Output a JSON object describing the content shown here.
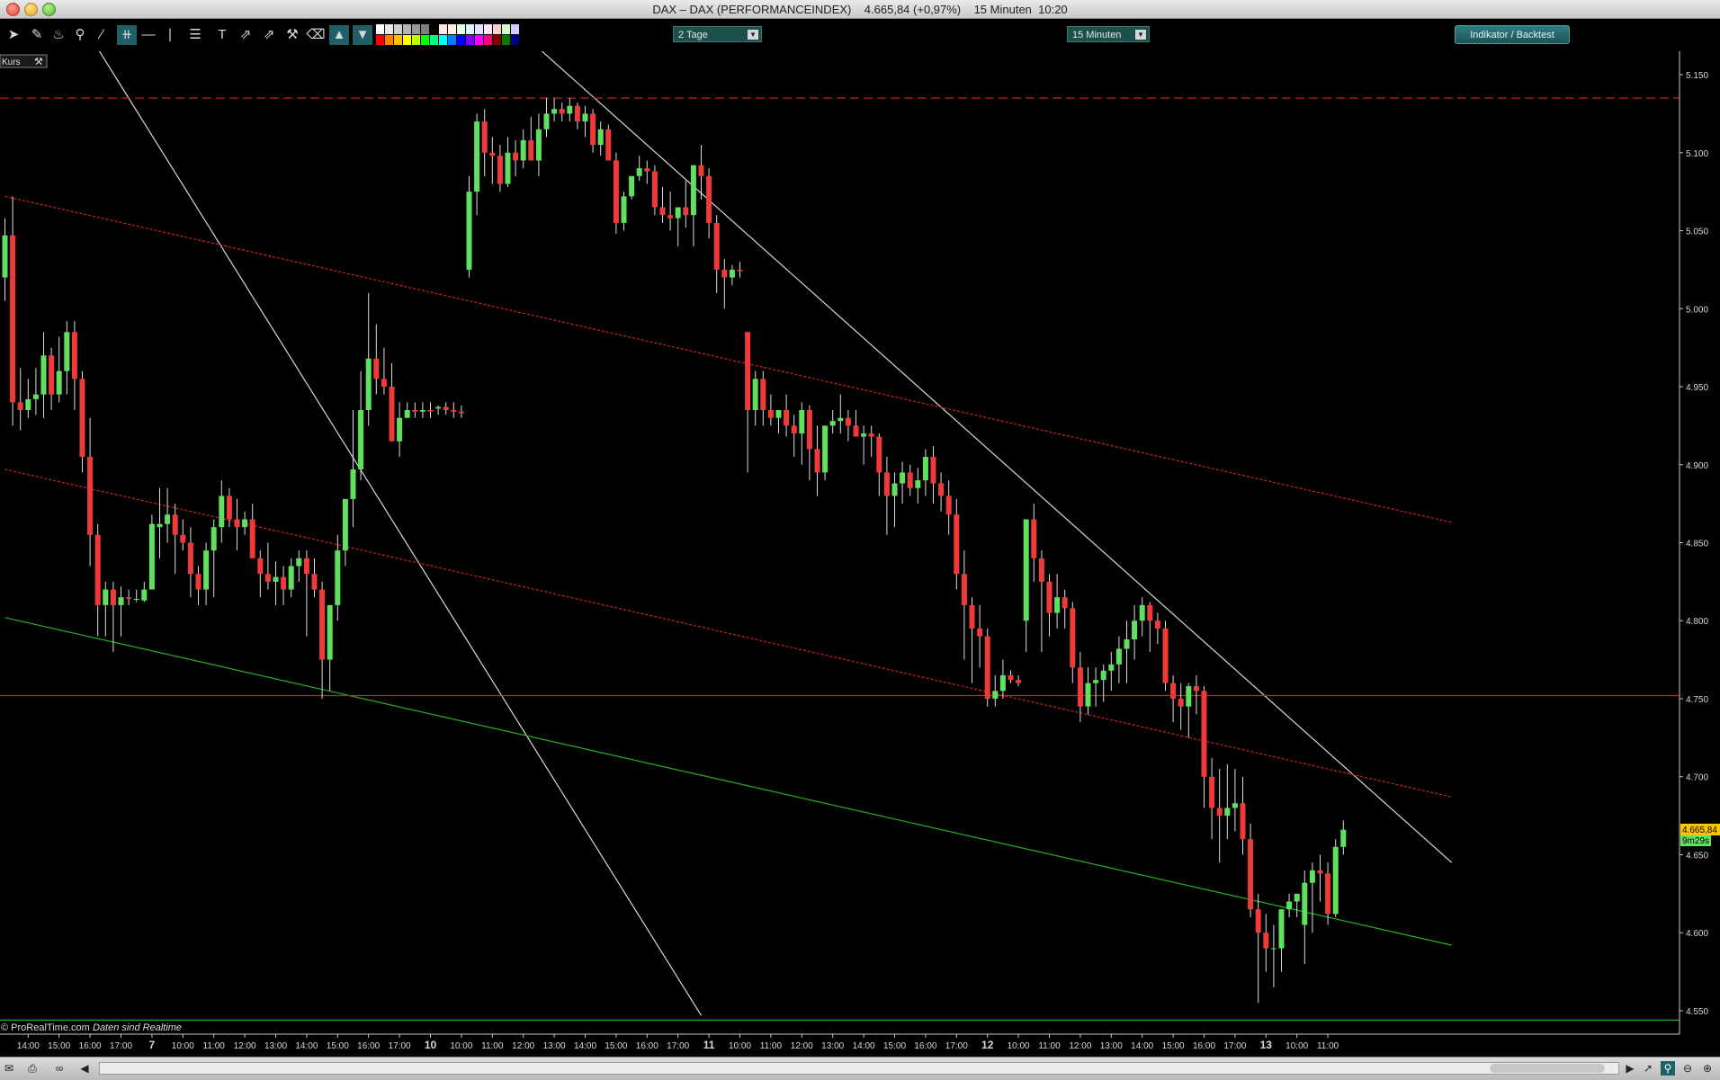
{
  "window": {
    "title": "DAX – DAX (PERFORMANCEINDEX)    4.665,84 (+0,97%)    15 Minuten  10:20"
  },
  "toolbar": {
    "period_dropdown": "2 Tage",
    "interval_dropdown": "15 Minuten",
    "indicator_button": "Indikator / Backtest",
    "tools": [
      "pointer-icon",
      "ruler-icon",
      "bell-icon",
      "zoom-icon",
      "line-icon",
      "channel-icon",
      "horizontal-line-icon",
      "vertical-line-icon",
      "fibonacci-icon",
      "text-icon",
      "trendline-icon",
      "trendline-icon",
      "wrench-icon",
      "trash-icon"
    ],
    "palette_top": [
      "#ffffff",
      "#e8e8e8",
      "#cfcfcf",
      "#b5b5b5",
      "#9a9a9a",
      "#7f7f7f",
      "#000000",
      "#ffe7e7",
      "#fff4d8",
      "#e4ffe4",
      "#d8f4ff",
      "#e4e4ff",
      "#ffe4ff",
      "#ffd0d0",
      "#d0ffd0",
      "#d0d0ff"
    ],
    "palette_bottom": [
      "#ff0000",
      "#ff7f00",
      "#ffbf00",
      "#ffff00",
      "#bfff00",
      "#00ff00",
      "#00ff7f",
      "#00ffff",
      "#007fff",
      "#0000ff",
      "#7f00ff",
      "#ff00ff",
      "#ff007f",
      "#7f0000",
      "#007f00",
      "#00007f"
    ]
  },
  "chart": {
    "panel_label": "Kurs",
    "footer": "© ProRealTime.com",
    "footer_note": "Daten sind Realtime",
    "last_price_label": "4.665,84",
    "countdown_label": "9m29s",
    "colors": {
      "up": "#5fe05f",
      "down": "#f03a3a",
      "wick": "#dcdcdc",
      "trend_white": "#d8d8d8",
      "trend_red": "#d42020",
      "trend_green": "#22b022"
    }
  },
  "chart_data": {
    "type": "candlestick",
    "ylim": [
      4535,
      5165
    ],
    "y_ticks": [
      {
        "value": 5150,
        "label": "5.150"
      },
      {
        "value": 5100,
        "label": "5.100"
      },
      {
        "value": 5050,
        "label": "5.050"
      },
      {
        "value": 5000,
        "label": "5.000"
      },
      {
        "value": 4950,
        "label": "4.950"
      },
      {
        "value": 4900,
        "label": "4.900"
      },
      {
        "value": 4850,
        "label": "4.850"
      },
      {
        "value": 4800,
        "label": "4.800"
      },
      {
        "value": 4750,
        "label": "4.750"
      },
      {
        "value": 4700,
        "label": "4.700"
      },
      {
        "value": 4650,
        "label": "4.650"
      },
      {
        "value": 4600,
        "label": "4.600"
      },
      {
        "value": 4550,
        "label": "4.550"
      }
    ],
    "x_ticks": [
      {
        "i": 3,
        "label": "14:00"
      },
      {
        "i": 7,
        "label": "15:00"
      },
      {
        "i": 11,
        "label": "16:00"
      },
      {
        "i": 15,
        "label": "17:00"
      },
      {
        "i": 19,
        "label": "7",
        "bold": true
      },
      {
        "i": 23,
        "label": "10:00"
      },
      {
        "i": 27,
        "label": "11:00"
      },
      {
        "i": 31,
        "label": "12:00"
      },
      {
        "i": 35,
        "label": "13:00"
      },
      {
        "i": 39,
        "label": "14:00"
      },
      {
        "i": 43,
        "label": "15:00"
      },
      {
        "i": 47,
        "label": "16:00"
      },
      {
        "i": 51,
        "label": "17:00"
      },
      {
        "i": 55,
        "label": "10",
        "bold": true
      },
      {
        "i": 59,
        "label": "10:00"
      },
      {
        "i": 63,
        "label": "11:00"
      },
      {
        "i": 67,
        "label": "12:00"
      },
      {
        "i": 71,
        "label": "13:00"
      },
      {
        "i": 75,
        "label": "14:00"
      },
      {
        "i": 79,
        "label": "15:00"
      },
      {
        "i": 83,
        "label": "16:00"
      },
      {
        "i": 87,
        "label": "17:00"
      },
      {
        "i": 91,
        "label": "11",
        "bold": true
      },
      {
        "i": 95,
        "label": "10:00"
      },
      {
        "i": 99,
        "label": "11:00"
      },
      {
        "i": 103,
        "label": "12:00"
      },
      {
        "i": 107,
        "label": "13:00"
      },
      {
        "i": 111,
        "label": "14:00"
      },
      {
        "i": 115,
        "label": "15:00"
      },
      {
        "i": 119,
        "label": "16:00"
      },
      {
        "i": 123,
        "label": "17:00"
      },
      {
        "i": 127,
        "label": "12",
        "bold": true
      },
      {
        "i": 131,
        "label": "10:00"
      },
      {
        "i": 135,
        "label": "11:00"
      },
      {
        "i": 139,
        "label": "12:00"
      },
      {
        "i": 143,
        "label": "13:00"
      },
      {
        "i": 147,
        "label": "14:00"
      },
      {
        "i": 151,
        "label": "15:00"
      },
      {
        "i": 155,
        "label": "16:00"
      },
      {
        "i": 159,
        "label": "17:00"
      },
      {
        "i": 163,
        "label": "13",
        "bold": true
      },
      {
        "i": 167,
        "label": "10:00"
      },
      {
        "i": 171,
        "label": "11:00"
      }
    ],
    "candles": [
      [
        5020,
        5058,
        5005,
        5047
      ],
      [
        5047,
        5072,
        4925,
        4940
      ],
      [
        4940,
        4962,
        4922,
        4935
      ],
      [
        4935,
        4955,
        4930,
        4942
      ],
      [
        4942,
        4962,
        4932,
        4945
      ],
      [
        4945,
        4985,
        4930,
        4970
      ],
      [
        4970,
        4975,
        4935,
        4945
      ],
      [
        4945,
        4982,
        4940,
        4960
      ],
      [
        4960,
        4992,
        4945,
        4985
      ],
      [
        4985,
        4992,
        4935,
        4955
      ],
      [
        4955,
        4960,
        4895,
        4905
      ],
      [
        4905,
        4930,
        4835,
        4855
      ],
      [
        4855,
        4862,
        4790,
        4810
      ],
      [
        4810,
        4825,
        4790,
        4820
      ],
      [
        4820,
        4825,
        4780,
        4810
      ],
      [
        4810,
        4822,
        4790,
        4815
      ],
      [
        4815,
        4820,
        4810,
        4814
      ],
      [
        4814,
        4820,
        4812,
        4814
      ],
      [
        4813,
        4825,
        4812,
        4820
      ],
      [
        4820,
        4868,
        4825,
        4862
      ],
      [
        4860,
        4885,
        4840,
        4862
      ],
      [
        4862,
        4885,
        4850,
        4868
      ],
      [
        4868,
        4875,
        4830,
        4855
      ],
      [
        4855,
        4865,
        4845,
        4850
      ],
      [
        4850,
        4860,
        4815,
        4830
      ],
      [
        4830,
        4835,
        4810,
        4820
      ],
      [
        4820,
        4850,
        4810,
        4845
      ],
      [
        4845,
        4865,
        4815,
        4860
      ],
      [
        4860,
        4890,
        4850,
        4880
      ],
      [
        4880,
        4885,
        4860,
        4865
      ],
      [
        4865,
        4878,
        4845,
        4860
      ],
      [
        4860,
        4870,
        4855,
        4865
      ],
      [
        4865,
        4875,
        4840,
        4840
      ],
      [
        4840,
        4845,
        4815,
        4830
      ],
      [
        4830,
        4850,
        4820,
        4825
      ],
      [
        4825,
        4838,
        4810,
        4828
      ],
      [
        4828,
        4835,
        4810,
        4820
      ],
      [
        4820,
        4840,
        4815,
        4835
      ],
      [
        4835,
        4845,
        4825,
        4840
      ],
      [
        4840,
        4845,
        4790,
        4830
      ],
      [
        4830,
        4840,
        4815,
        4820
      ],
      [
        4820,
        4825,
        4750,
        4775
      ],
      [
        4775,
        4810,
        4755,
        4810
      ],
      [
        4810,
        4855,
        4800,
        4845
      ],
      [
        4845,
        4878,
        4835,
        4878
      ],
      [
        4878,
        4935,
        4860,
        4897
      ],
      [
        4897,
        4960,
        4890,
        4935
      ],
      [
        4935,
        5010,
        4925,
        4968
      ],
      [
        4968,
        4990,
        4945,
        4955
      ],
      [
        4955,
        4975,
        4945,
        4950
      ],
      [
        4950,
        4965,
        4915,
        4915
      ],
      [
        4915,
        4940,
        4905,
        4930
      ],
      [
        4930,
        4940,
        4930,
        4935
      ],
      [
        4935,
        4940,
        4930,
        4934
      ],
      [
        4934,
        4940,
        4930,
        4935
      ],
      [
        4935,
        4940,
        4930,
        4934
      ],
      [
        4936,
        4938,
        4932,
        4937
      ],
      [
        4937,
        4940,
        4932,
        4935
      ],
      [
        4935,
        4940,
        4930,
        4934
      ],
      [
        4934,
        4938,
        4930,
        4933
      ],
      [
        5025,
        5085,
        5020,
        5075
      ],
      [
        5075,
        5125,
        5060,
        5120
      ],
      [
        5120,
        5128,
        5085,
        5100
      ],
      [
        5100,
        5110,
        5080,
        5098
      ],
      [
        5098,
        5105,
        5075,
        5080
      ],
      [
        5080,
        5110,
        5078,
        5100
      ],
      [
        5100,
        5108,
        5085,
        5095
      ],
      [
        5095,
        5115,
        5090,
        5108
      ],
      [
        5108,
        5123,
        5095,
        5095
      ],
      [
        5095,
        5125,
        5085,
        5115
      ],
      [
        5115,
        5135,
        5110,
        5125
      ],
      [
        5125,
        5135,
        5120,
        5128
      ],
      [
        5128,
        5132,
        5120,
        5125
      ],
      [
        5125,
        5135,
        5120,
        5130
      ],
      [
        5130,
        5132,
        5115,
        5120
      ],
      [
        5120,
        5130,
        5110,
        5125
      ],
      [
        5125,
        5128,
        5100,
        5105
      ],
      [
        5105,
        5120,
        5098,
        5115
      ],
      [
        5115,
        5118,
        5095,
        5095
      ],
      [
        5095,
        5100,
        5048,
        5055
      ],
      [
        5055,
        5075,
        5050,
        5072
      ],
      [
        5072,
        5085,
        5070,
        5085
      ],
      [
        5085,
        5098,
        5082,
        5090
      ],
      [
        5090,
        5095,
        5080,
        5088
      ],
      [
        5088,
        5092,
        5060,
        5065
      ],
      [
        5065,
        5078,
        5055,
        5060
      ],
      [
        5060,
        5075,
        5050,
        5058
      ],
      [
        5058,
        5065,
        5040,
        5065
      ],
      [
        5065,
        5082,
        5052,
        5060
      ],
      [
        5060,
        5090,
        5040,
        5092
      ],
      [
        5092,
        5105,
        5070,
        5085
      ],
      [
        5085,
        5090,
        5045,
        5055
      ],
      [
        5055,
        5060,
        5010,
        5025
      ],
      [
        5025,
        5032,
        5000,
        5020
      ],
      [
        5020,
        5028,
        5015,
        5025
      ],
      [
        5025,
        5030,
        5020,
        5024
      ],
      [
        4985,
        4985,
        4895,
        4935
      ],
      [
        4935,
        4960,
        4925,
        4955
      ],
      [
        4955,
        4960,
        4925,
        4935
      ],
      [
        4935,
        4945,
        4925,
        4930
      ],
      [
        4930,
        4935,
        4920,
        4935
      ],
      [
        4935,
        4945,
        4918,
        4925
      ],
      [
        4925,
        4932,
        4905,
        4920
      ],
      [
        4920,
        4940,
        4900,
        4935
      ],
      [
        4935,
        4938,
        4890,
        4910
      ],
      [
        4910,
        4925,
        4880,
        4895
      ],
      [
        4895,
        4925,
        4890,
        4925
      ],
      [
        4925,
        4935,
        4920,
        4928
      ],
      [
        4928,
        4945,
        4920,
        4930
      ],
      [
        4930,
        4935,
        4915,
        4925
      ],
      [
        4925,
        4935,
        4920,
        4918
      ],
      [
        4918,
        4925,
        4900,
        4920
      ],
      [
        4920,
        4925,
        4905,
        4918
      ],
      [
        4918,
        4920,
        4880,
        4895
      ],
      [
        4895,
        4905,
        4855,
        4880
      ],
      [
        4880,
        4895,
        4860,
        4888
      ],
      [
        4888,
        4902,
        4875,
        4895
      ],
      [
        4895,
        4900,
        4880,
        4885
      ],
      [
        4885,
        4898,
        4875,
        4890
      ],
      [
        4890,
        4910,
        4880,
        4905
      ],
      [
        4905,
        4912,
        4875,
        4888
      ],
      [
        4888,
        4895,
        4870,
        4880
      ],
      [
        4880,
        4890,
        4855,
        4868
      ],
      [
        4868,
        4878,
        4820,
        4830
      ],
      [
        4830,
        4845,
        4775,
        4810
      ],
      [
        4810,
        4815,
        4760,
        4795
      ],
      [
        4795,
        4810,
        4770,
        4790
      ],
      [
        4790,
        4795,
        4745,
        4750
      ],
      [
        4750,
        4765,
        4745,
        4755
      ],
      [
        4755,
        4775,
        4750,
        4765
      ],
      [
        4765,
        4768,
        4760,
        4762
      ],
      [
        4762,
        4765,
        4758,
        4760
      ],
      [
        4800,
        4865,
        4780,
        4865
      ],
      [
        4865,
        4875,
        4825,
        4840
      ],
      [
        4840,
        4845,
        4780,
        4825
      ],
      [
        4825,
        4830,
        4790,
        4805
      ],
      [
        4805,
        4830,
        4795,
        4815
      ],
      [
        4815,
        4820,
        4795,
        4808
      ],
      [
        4808,
        4812,
        4760,
        4770
      ],
      [
        4770,
        4780,
        4735,
        4745
      ],
      [
        4745,
        4770,
        4740,
        4760
      ],
      [
        4760,
        4770,
        4745,
        4762
      ],
      [
        4762,
        4772,
        4748,
        4768
      ],
      [
        4768,
        4780,
        4755,
        4772
      ],
      [
        4772,
        4790,
        4760,
        4782
      ],
      [
        4782,
        4800,
        4760,
        4788
      ],
      [
        4788,
        4810,
        4775,
        4800
      ],
      [
        4800,
        4815,
        4790,
        4810
      ],
      [
        4810,
        4812,
        4780,
        4800
      ],
      [
        4800,
        4805,
        4785,
        4795
      ],
      [
        4795,
        4800,
        4755,
        4760
      ],
      [
        4760,
        4765,
        4735,
        4750
      ],
      [
        4750,
        4760,
        4730,
        4745
      ],
      [
        4745,
        4760,
        4725,
        4758
      ],
      [
        4758,
        4765,
        4740,
        4755
      ],
      [
        4755,
        4758,
        4680,
        4700
      ],
      [
        4700,
        4712,
        4660,
        4680
      ],
      [
        4680,
        4705,
        4645,
        4675
      ],
      [
        4675,
        4708,
        4660,
        4680
      ],
      [
        4680,
        4705,
        4665,
        4683
      ],
      [
        4683,
        4700,
        4650,
        4660
      ],
      [
        4660,
        4670,
        4610,
        4615
      ],
      [
        4615,
        4625,
        4555,
        4600
      ],
      [
        4600,
        4612,
        4575,
        4590
      ],
      [
        4590,
        4605,
        4565,
        4590
      ],
      [
        4590,
        4615,
        4575,
        4615
      ],
      [
        4615,
        4625,
        4610,
        4620
      ],
      [
        4620,
        4625,
        4610,
        4625
      ],
      [
        4605,
        4640,
        4580,
        4632
      ],
      [
        4632,
        4645,
        4600,
        4640
      ],
      [
        4640,
        4650,
        4620,
        4638
      ],
      [
        4638,
        4645,
        4605,
        4612
      ],
      [
        4612,
        4660,
        4610,
        4655
      ],
      [
        4655,
        4672,
        4650,
        4666
      ]
    ],
    "lines": [
      {
        "type": "trend",
        "color": "white",
        "points": [
          [
            0,
            5262
          ],
          [
            90,
            4547
          ]
        ]
      },
      {
        "type": "trend",
        "color": "white",
        "points": [
          [
            0,
            5472
          ],
          [
            187,
            4645
          ]
        ]
      },
      {
        "type": "trend",
        "color": "red",
        "dashed": true,
        "points": [
          [
            0,
            5072
          ],
          [
            187,
            4863
          ]
        ]
      },
      {
        "type": "trend",
        "color": "red",
        "dashed": true,
        "points": [
          [
            0,
            4897
          ],
          [
            187,
            4687
          ]
        ]
      },
      {
        "type": "trend",
        "color": "green",
        "points": [
          [
            0,
            4802
          ],
          [
            187,
            4592
          ]
        ]
      },
      {
        "type": "hline",
        "color": "red",
        "dashed": true,
        "value": 5135
      },
      {
        "type": "hline",
        "color": "red",
        "value": 4752
      },
      {
        "type": "hline",
        "color": "green",
        "value": 4544
      }
    ],
    "last_price": 4665.84
  }
}
